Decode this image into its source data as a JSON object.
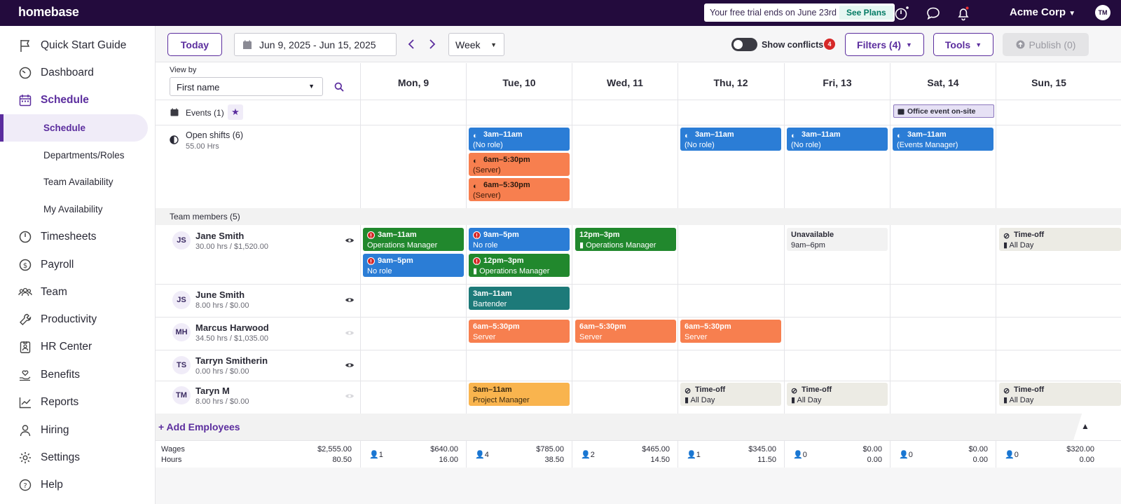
{
  "app": {
    "logo": "homebase",
    "company": "Acme Corp",
    "user_initials": "TM"
  },
  "trial": {
    "text": "Your free trial ends on June 23rd",
    "cta": "See Plans"
  },
  "sidebar": {
    "items": [
      {
        "label": "Quick Start Guide",
        "icon": "flag-icon"
      },
      {
        "label": "Dashboard",
        "icon": "gauge-icon"
      },
      {
        "label": "Schedule",
        "icon": "calendar-icon"
      },
      {
        "label": "Timesheets",
        "icon": "clock-icon"
      },
      {
        "label": "Payroll",
        "icon": "dollar-icon"
      },
      {
        "label": "Team",
        "icon": "team-icon"
      },
      {
        "label": "Productivity",
        "icon": "wrench-icon"
      },
      {
        "label": "HR Center",
        "icon": "id-badge-icon"
      },
      {
        "label": "Benefits",
        "icon": "heart-hand-icon"
      },
      {
        "label": "Reports",
        "icon": "chart-icon"
      },
      {
        "label": "Hiring",
        "icon": "person-icon"
      },
      {
        "label": "Settings",
        "icon": "gear-icon"
      },
      {
        "label": "Help",
        "icon": "help-icon"
      }
    ],
    "schedule_sub": [
      "Schedule",
      "Departments/Roles",
      "Team Availability",
      "My Availability"
    ]
  },
  "toolbar": {
    "today": "Today",
    "date_range": "Jun 9, 2025 - Jun 15, 2025",
    "view": "Week",
    "show_conflicts": "Show conflicts",
    "conflicts_count": "4",
    "filters": "Filters (4)",
    "tools": "Tools",
    "publish": "Publish (0)"
  },
  "grid": {
    "view_by_label": "View by",
    "view_by_value": "First name",
    "days": [
      "Mon, 9",
      "Tue, 10",
      "Wed, 11",
      "Thu, 12",
      "Fri, 13",
      "Sat, 14",
      "Sun, 15"
    ],
    "events_label": "Events (1)",
    "event": "Office event on-site",
    "open_shifts_label": "Open shifts (6)",
    "open_shifts_hours": "55.00 Hrs",
    "team_label": "Team members (5)",
    "add_employees": "+ Add Employees"
  },
  "open_shifts": [
    {
      "time": "3am–11am",
      "role": "(No role)"
    },
    {
      "time": "6am–5:30pm",
      "role": "(Server)"
    },
    {
      "time": "6am–5:30pm",
      "role": "(Server)"
    },
    {
      "time": "3am–11am",
      "role": "(No role)"
    },
    {
      "time": "3am–11am",
      "role": "(No role)"
    },
    {
      "time": "3am–11am",
      "role": "(Events Manager)"
    }
  ],
  "members": [
    {
      "initials": "JS",
      "name": "Jane Smith",
      "stats": "30.00 hrs / $1,520.00"
    },
    {
      "initials": "JS",
      "name": "June Smith",
      "stats": "8.00 hrs / $0.00"
    },
    {
      "initials": "MH",
      "name": "Marcus Harwood",
      "stats": "34.50 hrs / $1,035.00"
    },
    {
      "initials": "TS",
      "name": "Tarryn Smitherin",
      "stats": "0.00 hrs / $0.00"
    },
    {
      "initials": "TM",
      "name": "Taryn M",
      "stats": "8.00 hrs / $0.00"
    }
  ],
  "shifts": {
    "jane_mon_1": {
      "time": "3am–11am",
      "role": "Operations Manager"
    },
    "jane_mon_2": {
      "time": "9am–5pm",
      "role": "No role"
    },
    "jane_tue_1": {
      "time": "9am–5pm",
      "role": "No role"
    },
    "jane_tue_2": {
      "time": "12pm–3pm",
      "role": "Operations Manager"
    },
    "jane_wed": {
      "time": "12pm–3pm",
      "role": "Operations Manager"
    },
    "jane_fri": {
      "time": "Unavailable",
      "role": "9am–6pm"
    },
    "jane_sun": {
      "time": "Time-off",
      "role": "All Day"
    },
    "june_tue": {
      "time": "3am–11am",
      "role": "Bartender"
    },
    "marcus_tue": {
      "time": "6am–5:30pm",
      "role": "Server"
    },
    "marcus_wed": {
      "time": "6am–5:30pm",
      "role": "Server"
    },
    "marcus_thu": {
      "time": "6am–5:30pm",
      "role": "Server"
    },
    "taryn_tue": {
      "time": "3am–11am",
      "role": "Project Manager"
    },
    "taryn_thu": {
      "time": "Time-off",
      "role": "All Day"
    },
    "taryn_fri": {
      "time": "Time-off",
      "role": "All Day"
    },
    "taryn_sun": {
      "time": "Time-off",
      "role": "All Day"
    }
  },
  "footer": {
    "wages_label": "Wages",
    "hours_label": "Hours",
    "total_wages": "$2,555.00",
    "total_hours": "80.50",
    "days": [
      {
        "count": "1",
        "wages": "$640.00",
        "hours": "16.00"
      },
      {
        "count": "4",
        "wages": "$785.00",
        "hours": "38.50"
      },
      {
        "count": "2",
        "wages": "$465.00",
        "hours": "14.50"
      },
      {
        "count": "1",
        "wages": "$345.00",
        "hours": "11.50"
      },
      {
        "count": "0",
        "wages": "$0.00",
        "hours": "0.00"
      },
      {
        "count": "0",
        "wages": "$0.00",
        "hours": "0.00"
      },
      {
        "count": "0",
        "wages": "$320.00",
        "hours": "0.00"
      }
    ]
  },
  "colors": {
    "brand": "#230b3d",
    "accent": "#5b2d9e",
    "open_blue": "#2b7dd6",
    "server_orange": "#f77f4f",
    "ops_green": "#21882d",
    "bartender_teal": "#1d7a79",
    "pm_yellow": "#f9b44e"
  }
}
